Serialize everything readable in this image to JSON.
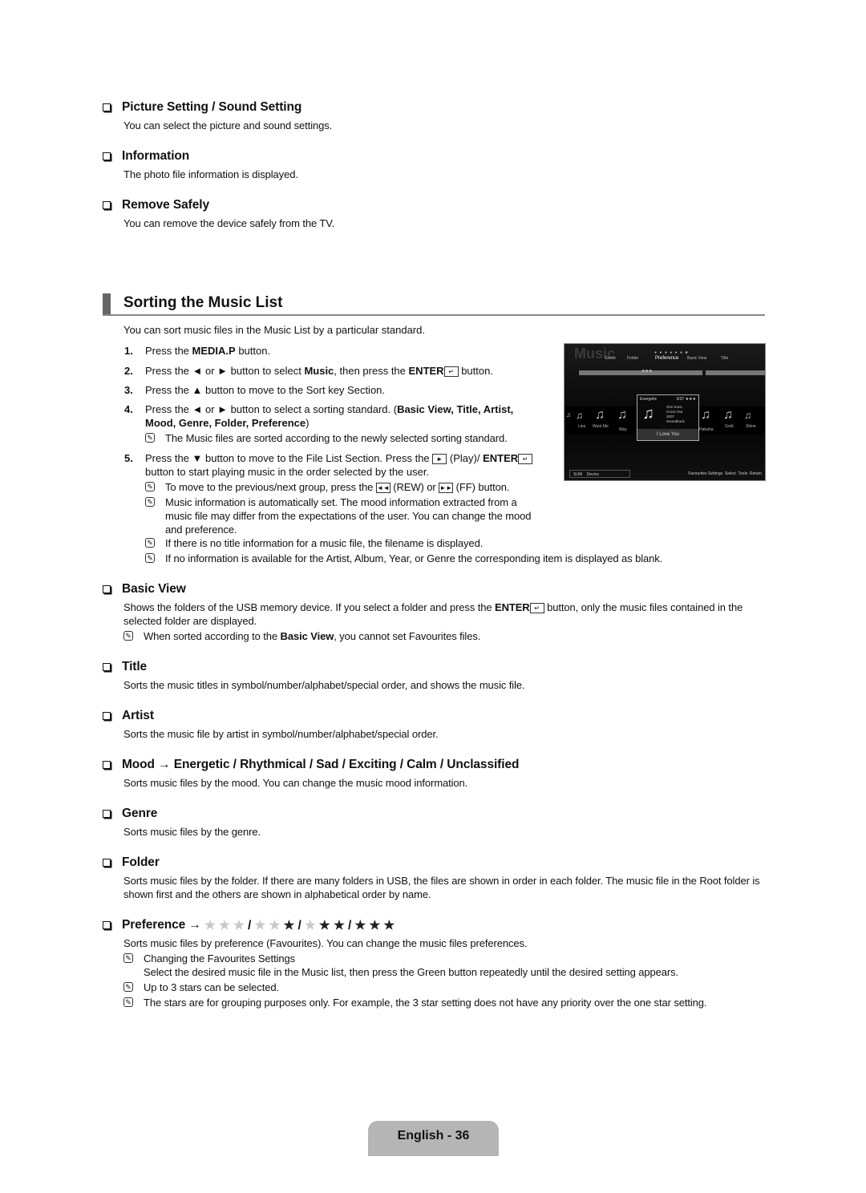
{
  "top_sections": [
    {
      "heading": "Picture Setting / Sound Setting",
      "desc": "You can select the picture and sound settings."
    },
    {
      "heading": "Information",
      "desc": "The photo file information is displayed."
    },
    {
      "heading": "Remove Safely",
      "desc": "You can remove the device safely from the TV."
    }
  ],
  "main": {
    "title": "Sorting the Music List",
    "intro": "You can sort music files in the Music List by a particular standard.",
    "steps": [
      {
        "num": "1.",
        "pre": "Press the ",
        "bold": "MEDIA.P",
        "post": " button."
      },
      {
        "num": "2.",
        "pre": "Press the ◄ or ► button to select ",
        "bold": "Music",
        "mid": ", then press the ",
        "bold2": "ENTER",
        "post": " button."
      },
      {
        "num": "3.",
        "text": "Press the ▲ button to move to the Sort key Section."
      },
      {
        "num": "4.",
        "pre": "Press the ◄ or ► button to select a sorting standard. (",
        "bold": "Basic View, Title, Artist, Mood, Genre, Folder, Preference",
        "post": ")"
      },
      {
        "num": "5.",
        "pre": "Press the ▼ button to move to the File List Section. Press the ",
        "key": "►",
        "mid": " (Play)/ ",
        "bold": "ENTER",
        "post": " button to start playing music in the order selected by the user."
      }
    ],
    "step4_note": "The Music files are sorted according to the newly selected sorting standard.",
    "step5_notes": {
      "rew_ff": {
        "pre": "To move to the previous/next group, press the ",
        "rew_key": "◄◄",
        "rew": " (REW) or ",
        "ff_key": "►►",
        "ff": " (FF) button."
      },
      "mood_info": "Music information is automatically set. The mood information extracted from a music file may differ from the expectations of the user. You can change the mood and preference.",
      "no_title": "If there is no title information for a music file, the filename is displayed.",
      "no_info": "If no information is available for the Artist, Album, Year, or Genre the corresponding item is displayed as blank."
    }
  },
  "tv_screen": {
    "logo": "Music",
    "sort_keys": [
      "Genre",
      "Folder",
      "Preference",
      "Basic View",
      "Title"
    ],
    "selected_sort": "Preference",
    "page_dots": "● ● ● ● ● ● ■",
    "bar_stars": "★★★",
    "items_left": [
      "Lies",
      "Want Me",
      "Way"
    ],
    "items_right": [
      "Hahaha",
      "Gold",
      "Shine"
    ],
    "selected": {
      "mood": "Energetic",
      "count": "3/37",
      "stars": "★★★",
      "artist": "Gim Kuns",
      "album": "Cross Out",
      "year": "2007",
      "genre": "Soundtrack",
      "title": "I Love You"
    },
    "device_label": "SUM",
    "device_btn": "Device",
    "controls": [
      "Favourites Settings",
      "Select",
      "Tools",
      "Return"
    ]
  },
  "sorts": [
    {
      "heading": "Basic View",
      "desc_pre": "Shows the folders of the USB memory device. If you select a folder and press the ",
      "desc_bold": "ENTER",
      "desc_post": " button, only the music files contained in the selected folder are displayed.",
      "note_pre": "When sorted according to the ",
      "note_bold": "Basic View",
      "note_post": ", you cannot set Favourites files."
    },
    {
      "heading": "Title",
      "desc": "Sorts the music titles in symbol/number/alphabet/special order, and shows the music file."
    },
    {
      "heading": "Artist",
      "desc": "Sorts the music file by artist in symbol/number/alphabet/special order."
    },
    {
      "heading": "Mood → Energetic / Rhythmical / Sad / Exciting / Calm / Unclassified",
      "desc": "Sorts music files by the mood. You can change the music mood information."
    },
    {
      "heading": "Genre",
      "desc": "Sorts music files by the genre."
    },
    {
      "heading": "Folder",
      "desc": "Sorts music files by the folder. If there are many folders in USB, the files are shown in order in each folder. The music file in the Root folder is shown first and the others are shown in alphabetical order by name."
    },
    {
      "heading": "Preference →",
      "star_levels": [
        0,
        1,
        2,
        3
      ],
      "desc": "Sorts music files by preference (Favourites). You can change the music files preferences.",
      "note1_title": "Changing the Favourites Settings",
      "note1_body": "Select the desired music file in the Music list, then press the Green button repeatedly until the desired setting appears.",
      "note2": "Up to 3 stars can be selected.",
      "note3": "The stars are for grouping purposes only. For example, the 3 star setting does not have any priority over the one star setting."
    }
  ],
  "footer": {
    "page_label": "English - 36"
  },
  "icons": {
    "note": "✎",
    "enter": "↵"
  }
}
